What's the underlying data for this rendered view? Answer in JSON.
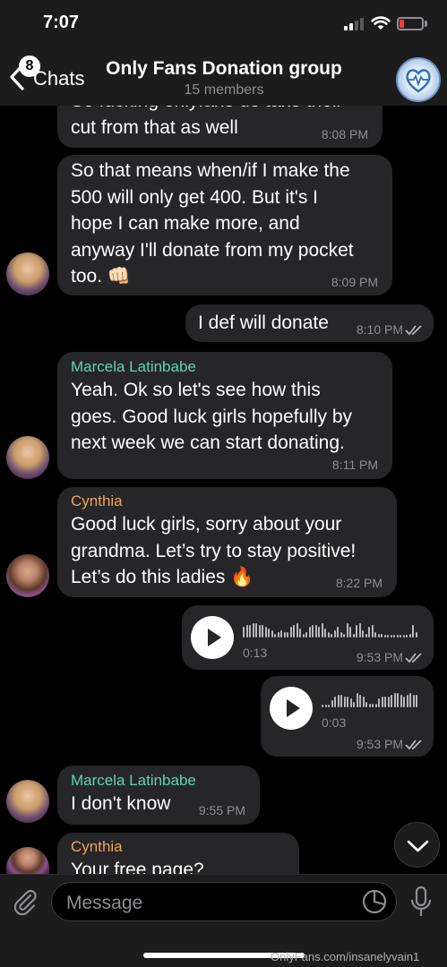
{
  "status_bar": {
    "time": "7:07"
  },
  "header": {
    "back_label": "Chats",
    "back_badge": "8",
    "title": "Only Fans Donation group",
    "subtitle": "15 members"
  },
  "messages": [
    {
      "sender": "",
      "text": "So fucking onlyfans do take their\ncut from that as well",
      "time": "8:08 PM"
    },
    {
      "sender": "",
      "text": "So that means when/if I make the\n500 will only get 400. But it's I\nhope I can make more, and\nanyway I'll donate from my pocket\ntoo. 👊🏻",
      "time": "8:09 PM"
    },
    {
      "sender": "",
      "text": "I def will donate",
      "time": "8:10 PM"
    },
    {
      "sender": "Marcela Latinbabe",
      "text": "Yeah. Ok so let's see how this\ngoes. Good luck girls hopefully by\nnext week we can start donating.",
      "time": "8:11 PM"
    },
    {
      "sender": "Cynthia",
      "text": "Good luck girls, sorry about your\ngrandma. Let’s try to stay positive!\nLet’s do this ladies 🔥",
      "time": "8:22 PM"
    },
    {
      "sender": "",
      "text": "",
      "duration": "0:13",
      "time": "9:53 PM"
    },
    {
      "sender": "",
      "text": "",
      "duration": "0:03",
      "time": "9:53 PM"
    },
    {
      "sender": "Marcela Latinbabe",
      "text": "I don't know",
      "time": "9:55 PM"
    },
    {
      "sender": "Cynthia",
      "text": "Your free page?",
      "time": ""
    }
  ],
  "colors": {
    "marcela": "#5fd3b0",
    "cynthia": "#f0a25a",
    "bubble": "#262628",
    "bar": "#1c1c1d"
  },
  "input": {
    "placeholder": "Message"
  },
  "watermark": "OnlyFans.com/insanelyvain1",
  "icons": {
    "back": "chevron-left-icon",
    "attach": "paperclip-icon",
    "sticker": "sticker-icon",
    "mic": "microphone-icon",
    "scroll": "chevron-down-icon",
    "read": "double-check-icon"
  }
}
